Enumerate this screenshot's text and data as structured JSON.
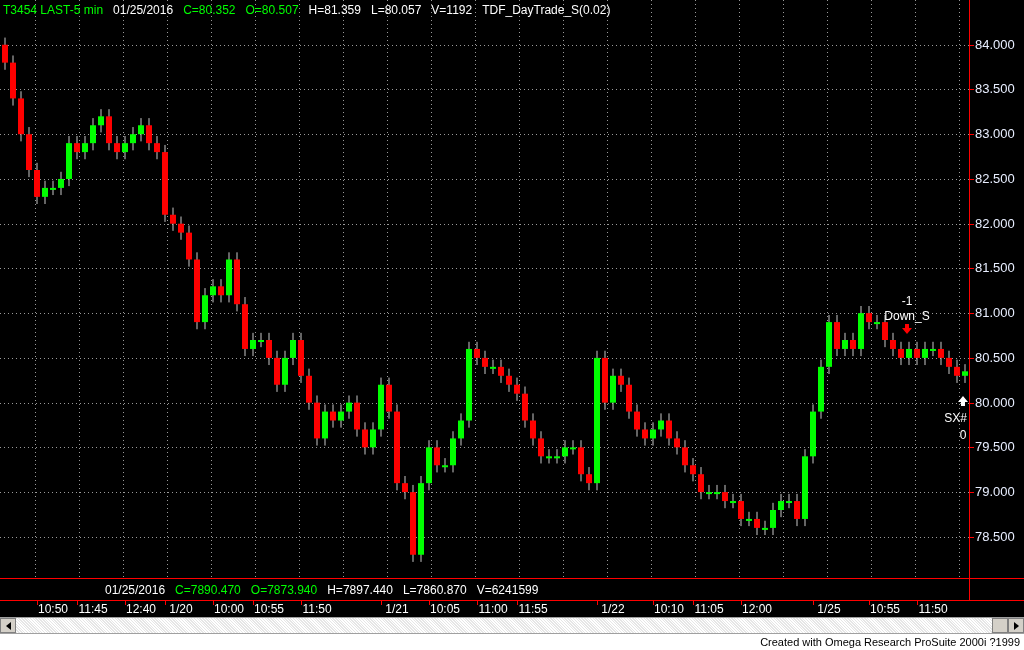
{
  "header": [
    {
      "text": "T3454 LAST-5 min",
      "color": "#00ff00"
    },
    {
      "text": "01/25/2016",
      "color": "#ffffff"
    },
    {
      "text": "C=80.352",
      "color": "#00ff00"
    },
    {
      "text": "O=80.507",
      "color": "#00ff00"
    },
    {
      "text": "H=81.359",
      "color": "#ffffff"
    },
    {
      "text": "L=80.057",
      "color": "#ffffff"
    },
    {
      "text": "V=1192",
      "color": "#ffffff"
    },
    {
      "text": "TDF_DayTrade_S(0.02)",
      "color": "#ffffff"
    }
  ],
  "chart": {
    "chart_data": {
      "type": "candlestick",
      "grid": true,
      "ylim": [
        78.04,
        84.5
      ],
      "categories": [
        null,
        null,
        null,
        null,
        null,
        null,
        "10:50",
        null,
        null,
        null,
        null,
        "11:45",
        null,
        null,
        null,
        null,
        null,
        "12:40",
        null,
        null,
        null,
        null,
        "1/20",
        null,
        null,
        null,
        null,
        null,
        "10:00",
        null,
        null,
        null,
        null,
        "10:55",
        null,
        null,
        null,
        null,
        null,
        "11:50",
        null,
        null,
        null,
        null,
        null,
        null,
        null,
        null,
        null,
        "1/21",
        null,
        null,
        null,
        null,
        null,
        "10:05",
        null,
        null,
        null,
        null,
        null,
        "11:00",
        null,
        null,
        null,
        null,
        "11:55",
        null,
        null,
        null,
        null,
        null,
        null,
        null,
        null,
        null,
        "1/22",
        null,
        null,
        null,
        null,
        null,
        null,
        "10:10",
        null,
        null,
        null,
        null,
        "11:05",
        null,
        null,
        null,
        null,
        null,
        "12:00",
        null,
        null,
        null,
        null,
        null,
        null,
        null,
        null,
        "1/25",
        null,
        null,
        null,
        null,
        null,
        null,
        "10:55",
        null,
        null,
        null,
        null,
        null,
        "11:50",
        null,
        null,
        null,
        null
      ],
      "ohlc": [
        [
          84.0,
          84.08,
          83.72,
          83.8
        ],
        [
          83.8,
          83.88,
          83.32,
          83.4
        ],
        [
          83.4,
          83.48,
          82.92,
          83.0
        ],
        [
          83.0,
          83.08,
          82.52,
          82.6
        ],
        [
          82.6,
          82.68,
          82.22,
          82.3
        ],
        [
          82.3,
          82.48,
          82.22,
          82.4
        ],
        [
          82.4,
          82.48,
          82.32,
          82.4
        ],
        [
          82.4,
          82.58,
          82.32,
          82.5
        ],
        [
          82.5,
          82.98,
          82.42,
          82.9
        ],
        [
          82.9,
          82.98,
          82.72,
          82.8
        ],
        [
          82.8,
          82.98,
          82.72,
          82.9
        ],
        [
          82.9,
          83.18,
          82.82,
          83.1
        ],
        [
          83.1,
          83.28,
          83.02,
          83.2
        ],
        [
          83.2,
          83.28,
          82.82,
          82.9
        ],
        [
          82.9,
          82.98,
          82.72,
          82.8
        ],
        [
          82.8,
          82.98,
          82.72,
          82.9
        ],
        [
          82.9,
          83.08,
          82.82,
          83.0
        ],
        [
          83.0,
          83.18,
          82.92,
          83.1
        ],
        [
          83.1,
          83.18,
          82.82,
          82.9
        ],
        [
          82.9,
          82.98,
          82.72,
          82.8
        ],
        [
          82.8,
          82.88,
          82.02,
          82.1
        ],
        [
          82.1,
          82.18,
          81.92,
          82.0
        ],
        [
          82.0,
          82.08,
          81.82,
          81.9
        ],
        [
          81.9,
          81.98,
          81.52,
          81.6
        ],
        [
          81.6,
          81.68,
          80.82,
          80.9
        ],
        [
          80.9,
          81.28,
          80.82,
          81.2
        ],
        [
          81.2,
          81.38,
          81.12,
          81.3
        ],
        [
          81.3,
          81.38,
          81.12,
          81.2
        ],
        [
          81.2,
          81.68,
          81.12,
          81.6
        ],
        [
          81.6,
          81.68,
          81.02,
          81.1
        ],
        [
          81.1,
          81.18,
          80.52,
          80.6
        ],
        [
          80.6,
          80.78,
          80.52,
          80.7
        ],
        [
          80.7,
          80.78,
          80.62,
          80.7
        ],
        [
          80.7,
          80.78,
          80.42,
          80.5
        ],
        [
          80.5,
          80.58,
          80.12,
          80.2
        ],
        [
          80.2,
          80.58,
          80.12,
          80.5
        ],
        [
          80.5,
          80.78,
          80.42,
          80.7
        ],
        [
          80.7,
          80.78,
          80.22,
          80.3
        ],
        [
          80.3,
          80.38,
          79.92,
          80.0
        ],
        [
          80.0,
          80.08,
          79.52,
          79.6
        ],
        [
          79.6,
          79.98,
          79.52,
          79.9
        ],
        [
          79.9,
          79.98,
          79.72,
          79.8
        ],
        [
          79.8,
          79.98,
          79.72,
          79.9
        ],
        [
          79.9,
          80.08,
          79.82,
          80.0
        ],
        [
          80.0,
          80.08,
          79.62,
          79.7
        ],
        [
          79.7,
          79.78,
          79.42,
          79.5
        ],
        [
          79.5,
          79.78,
          79.42,
          79.7
        ],
        [
          79.7,
          80.28,
          79.62,
          80.2
        ],
        [
          80.2,
          80.28,
          79.82,
          79.9
        ],
        [
          79.9,
          79.98,
          79.02,
          79.1
        ],
        [
          79.1,
          79.18,
          78.92,
          79.0
        ],
        [
          79.0,
          79.08,
          78.22,
          78.3
        ],
        [
          78.3,
          79.18,
          78.22,
          79.1
        ],
        [
          79.1,
          79.58,
          79.02,
          79.5
        ],
        [
          79.5,
          79.58,
          79.22,
          79.3
        ],
        [
          79.3,
          79.38,
          79.22,
          79.3
        ],
        [
          79.3,
          79.68,
          79.22,
          79.6
        ],
        [
          79.6,
          79.88,
          79.52,
          79.8
        ],
        [
          79.8,
          80.68,
          79.72,
          80.6
        ],
        [
          80.6,
          80.68,
          80.42,
          80.5
        ],
        [
          80.5,
          80.58,
          80.32,
          80.4
        ],
        [
          80.4,
          80.48,
          80.32,
          80.4
        ],
        [
          80.4,
          80.48,
          80.22,
          80.3
        ],
        [
          80.3,
          80.38,
          80.12,
          80.2
        ],
        [
          80.2,
          80.28,
          80.02,
          80.1
        ],
        [
          80.1,
          80.18,
          79.72,
          79.8
        ],
        [
          79.8,
          79.88,
          79.52,
          79.6
        ],
        [
          79.6,
          79.68,
          79.32,
          79.4
        ],
        [
          79.4,
          79.48,
          79.32,
          79.4
        ],
        [
          79.4,
          79.48,
          79.32,
          79.4
        ],
        [
          79.4,
          79.58,
          79.32,
          79.5
        ],
        [
          79.5,
          79.58,
          79.42,
          79.5
        ],
        [
          79.5,
          79.58,
          79.12,
          79.2
        ],
        [
          79.2,
          79.28,
          79.02,
          79.1
        ],
        [
          79.1,
          80.58,
          79.02,
          80.5
        ],
        [
          80.5,
          80.58,
          79.92,
          80.0
        ],
        [
          80.0,
          80.38,
          79.92,
          80.3
        ],
        [
          80.3,
          80.38,
          80.12,
          80.2
        ],
        [
          80.2,
          80.28,
          79.82,
          79.9
        ],
        [
          79.9,
          79.98,
          79.62,
          79.7
        ],
        [
          79.7,
          79.78,
          79.52,
          79.6
        ],
        [
          79.6,
          79.78,
          79.52,
          79.7
        ],
        [
          79.7,
          79.88,
          79.62,
          79.8
        ],
        [
          79.8,
          79.88,
          79.52,
          79.6
        ],
        [
          79.6,
          79.68,
          79.42,
          79.5
        ],
        [
          79.5,
          79.58,
          79.22,
          79.3
        ],
        [
          79.3,
          79.38,
          79.12,
          79.2
        ],
        [
          79.2,
          79.28,
          78.92,
          79.0
        ],
        [
          79.0,
          79.08,
          78.92,
          79.0
        ],
        [
          79.0,
          79.08,
          78.92,
          79.0
        ],
        [
          79.0,
          79.08,
          78.82,
          78.9
        ],
        [
          78.9,
          78.98,
          78.82,
          78.9
        ],
        [
          78.9,
          78.98,
          78.62,
          78.7
        ],
        [
          78.7,
          78.78,
          78.62,
          78.7
        ],
        [
          78.7,
          78.78,
          78.52,
          78.6
        ],
        [
          78.6,
          78.68,
          78.52,
          78.6
        ],
        [
          78.6,
          78.88,
          78.52,
          78.8
        ],
        [
          78.8,
          78.98,
          78.72,
          78.9
        ],
        [
          78.9,
          78.98,
          78.82,
          78.9
        ],
        [
          78.9,
          78.98,
          78.62,
          78.7
        ],
        [
          78.7,
          79.48,
          78.62,
          79.4
        ],
        [
          79.4,
          79.98,
          79.32,
          79.9
        ],
        [
          79.9,
          80.48,
          79.82,
          80.4
        ],
        [
          80.4,
          80.98,
          80.32,
          80.9
        ],
        [
          80.9,
          80.98,
          80.52,
          80.6
        ],
        [
          80.6,
          80.78,
          80.52,
          80.7
        ],
        [
          80.7,
          80.78,
          80.52,
          80.6
        ],
        [
          80.6,
          81.08,
          80.52,
          81.0
        ],
        [
          81.0,
          81.08,
          80.82,
          80.9
        ],
        [
          80.9,
          80.98,
          80.82,
          80.9
        ],
        [
          80.9,
          80.98,
          80.62,
          80.7
        ],
        [
          80.7,
          80.78,
          80.52,
          80.6
        ],
        [
          80.6,
          80.68,
          80.42,
          80.5
        ],
        [
          80.5,
          80.68,
          80.42,
          80.6
        ],
        [
          80.6,
          80.68,
          80.42,
          80.5
        ],
        [
          80.5,
          80.68,
          80.42,
          80.6
        ],
        [
          80.6,
          80.68,
          80.52,
          80.6
        ],
        [
          80.6,
          80.68,
          80.42,
          80.5
        ],
        [
          80.5,
          80.58,
          80.32,
          80.4
        ],
        [
          80.4,
          80.48,
          80.22,
          80.3
        ],
        [
          80.3,
          80.43,
          80.22,
          80.35
        ]
      ],
      "yticks": [
        {
          "value": 84,
          "label": "84.000"
        },
        {
          "value": 83.5,
          "label": "83.500"
        },
        {
          "value": 83,
          "label": "83.000"
        },
        {
          "value": 82.5,
          "label": "82.500"
        },
        {
          "value": 82,
          "label": "82.000"
        },
        {
          "value": 81.5,
          "label": "81.500"
        },
        {
          "value": 81,
          "label": "81.000"
        },
        {
          "value": 80.5,
          "label": "80.500"
        },
        {
          "value": 80,
          "label": "80.000"
        },
        {
          "value": 79.5,
          "label": "79.500"
        },
        {
          "value": 79,
          "label": "79.000"
        },
        {
          "value": 78.5,
          "label": "78.500"
        }
      ],
      "annotations": [
        "-1",
        "Down_S",
        "SX#",
        "0"
      ]
    },
    "markers": [
      {
        "kind": "arrow-down",
        "color": "#ff0000"
      },
      {
        "kind": "arrow-up",
        "color": "#ffffff"
      }
    ]
  },
  "info": [
    {
      "text": "01/25/2016",
      "color": "#ffffff"
    },
    {
      "text": "C=7890.470",
      "color": "#00ff00"
    },
    {
      "text": "O=7873.940",
      "color": "#00ff00"
    },
    {
      "text": "H=7897.440",
      "color": "#ffffff"
    },
    {
      "text": "L=7860.870",
      "color": "#ffffff"
    },
    {
      "text": "V=6241599",
      "color": "#ffffff"
    }
  ],
  "footer": "Created with Omega Research ProSuite 2000i ?1999"
}
